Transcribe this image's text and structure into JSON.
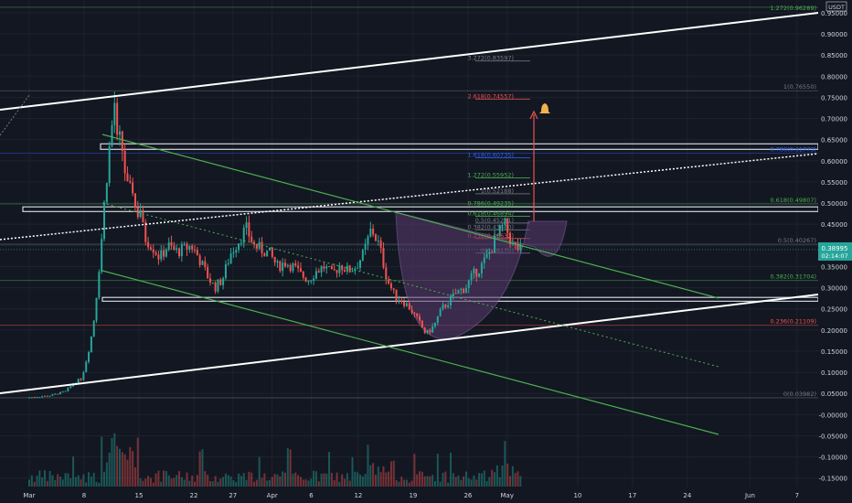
{
  "colors": {
    "background": "#131722",
    "up": "#26a69a",
    "down": "#ef5350",
    "grid": "#1e222d",
    "axis_text": "#d1d4dc",
    "channel_white": "#ffffff",
    "channel_green": "#4caf50",
    "cup_fill": "#5b3a6e",
    "fib_red": "#ef5350",
    "fib_gray": "#787b86",
    "fib_green": "#4caf50",
    "fib_blue": "#2962ff",
    "alert": "#f0b34a"
  },
  "chart_data": {
    "type": "candlestick",
    "currency": "USDT",
    "ylim": [
      -0.17,
      0.98
    ],
    "y_ticks": [
      "0.95000",
      "0.90000",
      "0.85000",
      "0.80000",
      "0.75000",
      "0.70000",
      "0.65000",
      "0.60000",
      "0.55000",
      "0.50000",
      "0.45000",
      "0.40000",
      "0.35000",
      "0.30000",
      "0.25000",
      "0.20000",
      "0.15000",
      "0.10000",
      "0.05000",
      "-0.00000",
      "-0.05000",
      "-0.10000",
      "-0.15000"
    ],
    "y_tick_values": [
      0.95,
      0.9,
      0.85,
      0.8,
      0.75,
      0.7,
      0.65,
      0.6,
      0.55,
      0.5,
      0.45,
      0.4,
      0.35,
      0.3,
      0.25,
      0.2,
      0.15,
      0.1,
      0.05,
      0.0,
      -0.05,
      -0.1,
      -0.15
    ],
    "x_ticks": [
      {
        "label": "Mar",
        "day": 0
      },
      {
        "label": "8",
        "day": 7
      },
      {
        "label": "15",
        "day": 14
      },
      {
        "label": "22",
        "day": 21
      },
      {
        "label": "27",
        "day": 26
      },
      {
        "label": "Apr",
        "day": 31
      },
      {
        "label": "6",
        "day": 36
      },
      {
        "label": "12",
        "day": 42
      },
      {
        "label": "19",
        "day": 49
      },
      {
        "label": "26",
        "day": 56
      },
      {
        "label": "May",
        "day": 61
      },
      {
        "label": "10",
        "day": 70
      },
      {
        "label": "17",
        "day": 77
      },
      {
        "label": "24",
        "day": 84
      },
      {
        "label": "Jun",
        "day": 92
      },
      {
        "label": "7",
        "day": 98
      }
    ],
    "current_price": "0.38995",
    "countdown": "02:14:07",
    "top_label": "1.272(0.96289)",
    "price_points": [
      [
        0,
        0.04
      ],
      [
        3,
        0.045
      ],
      [
        5,
        0.055
      ],
      [
        6,
        0.075
      ],
      [
        7,
        0.085
      ],
      [
        7.5,
        0.12
      ],
      [
        8,
        0.16
      ],
      [
        8.5,
        0.21
      ],
      [
        9,
        0.3
      ],
      [
        9.5,
        0.4
      ],
      [
        10,
        0.52
      ],
      [
        10.5,
        0.62
      ],
      [
        11,
        0.7
      ],
      [
        11.3,
        0.75
      ],
      [
        11.6,
        0.62
      ],
      [
        12,
        0.66
      ],
      [
        12.5,
        0.58
      ],
      [
        13,
        0.52
      ],
      [
        13.5,
        0.54
      ],
      [
        14,
        0.47
      ],
      [
        14.5,
        0.49
      ],
      [
        15,
        0.42
      ],
      [
        16,
        0.4
      ],
      [
        17,
        0.37
      ],
      [
        18,
        0.4
      ],
      [
        19,
        0.385
      ],
      [
        20,
        0.39
      ],
      [
        21,
        0.4
      ],
      [
        22,
        0.37
      ],
      [
        23,
        0.33
      ],
      [
        24,
        0.3
      ],
      [
        25,
        0.32
      ],
      [
        26,
        0.38
      ],
      [
        27,
        0.41
      ],
      [
        28,
        0.44
      ],
      [
        29,
        0.4
      ],
      [
        30,
        0.39
      ],
      [
        31,
        0.38
      ],
      [
        32,
        0.35
      ],
      [
        33,
        0.36
      ],
      [
        34,
        0.35
      ],
      [
        35,
        0.33
      ],
      [
        36,
        0.32
      ],
      [
        37,
        0.34
      ],
      [
        38,
        0.35
      ],
      [
        39,
        0.33
      ],
      [
        40,
        0.355
      ],
      [
        41,
        0.34
      ],
      [
        42,
        0.35
      ],
      [
        43,
        0.38
      ],
      [
        44,
        0.44
      ],
      [
        45,
        0.4
      ],
      [
        46,
        0.32
      ],
      [
        47,
        0.28
      ],
      [
        48,
        0.27
      ],
      [
        49,
        0.25
      ],
      [
        50,
        0.22
      ],
      [
        51,
        0.19
      ],
      [
        52,
        0.21
      ],
      [
        53,
        0.25
      ],
      [
        54,
        0.27
      ],
      [
        55,
        0.29
      ],
      [
        56,
        0.3
      ],
      [
        57,
        0.33
      ],
      [
        58,
        0.35
      ],
      [
        59,
        0.38
      ],
      [
        60,
        0.42
      ],
      [
        61,
        0.45
      ],
      [
        62,
        0.4
      ],
      [
        63,
        0.39
      ]
    ],
    "fib_levels_left": [
      {
        "label": "3.272(0.83597)",
        "value": 0.836,
        "color": "fib_gray"
      },
      {
        "label": "2.618(0.74557)",
        "value": 0.7456,
        "color": "fib_red"
      },
      {
        "label": "1.618(0.60735)",
        "value": 0.607,
        "color": "fib_blue"
      },
      {
        "label": "1.272(0.55952)",
        "value": 0.5595,
        "color": "fib_green"
      },
      {
        "label": "1(0.52188)",
        "value": 0.5219,
        "color": "fib_gray"
      },
      {
        "label": "0.786(0.49235)",
        "value": 0.4924,
        "color": "fib_green"
      },
      {
        "label": "0.618(0.46894)",
        "value": 0.4689,
        "color": "fib_green"
      },
      {
        "label": "0.5(0.45281)",
        "value": 0.4528,
        "color": "fib_gray"
      },
      {
        "label": "0.382(0.43650)",
        "value": 0.4365,
        "color": "fib_gray"
      },
      {
        "label": "0.236(0.41632)",
        "value": 0.4163,
        "color": "fib_red"
      },
      {
        "label": "0(0.38170)",
        "value": 0.3817,
        "color": "fib_gray"
      }
    ],
    "fib_levels_right": [
      {
        "label": "1(0.76550)",
        "value": 0.7655,
        "color": "fib_gray"
      },
      {
        "label": "0.786(0.61773)",
        "value": 0.6177,
        "color": "fib_blue"
      },
      {
        "label": "0.618(0.49807)",
        "value": 0.4981,
        "color": "fib_green"
      },
      {
        "label": "0.5(0.40267)",
        "value": 0.4027,
        "color": "fib_gray"
      },
      {
        "label": "0.382(0.31704)",
        "value": 0.317,
        "color": "fib_green"
      },
      {
        "label": "0.236(0.21109)",
        "value": 0.2111,
        "color": "fib_red"
      },
      {
        "label": "0(0.03982)",
        "value": 0.0398,
        "color": "fib_gray"
      }
    ],
    "zones": [
      {
        "name": "resistance-zone-upper",
        "from": 0.627,
        "to": 0.64
      },
      {
        "name": "resistance-zone-mid",
        "from": 0.48,
        "to": 0.491
      },
      {
        "name": "support-zone",
        "from": 0.268,
        "to": 0.277
      }
    ]
  }
}
